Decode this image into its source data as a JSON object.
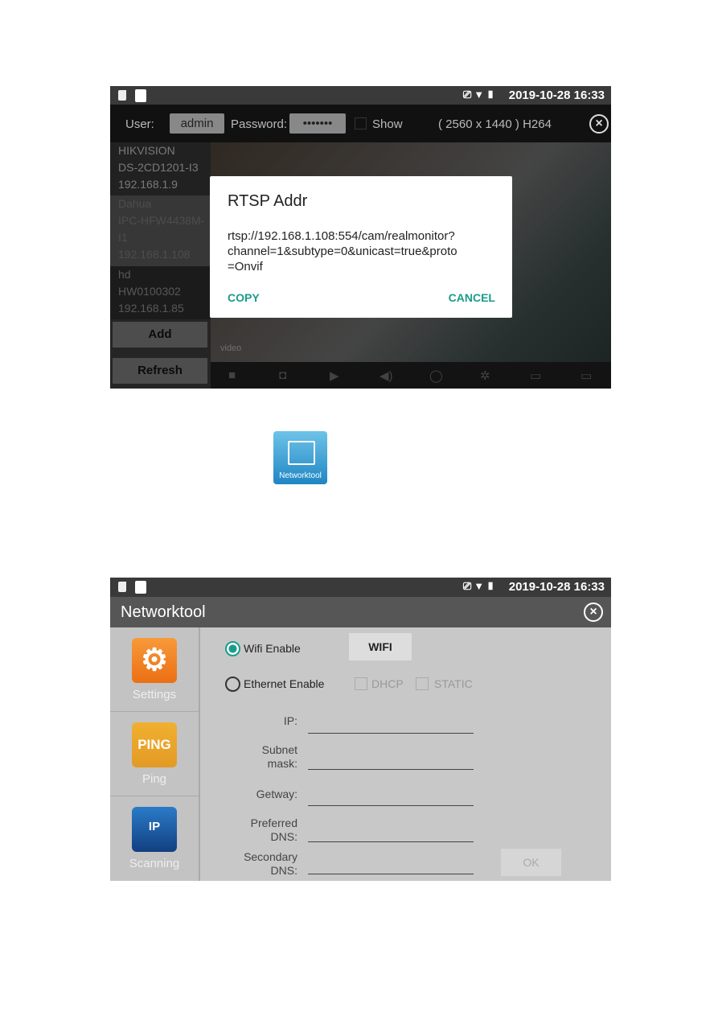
{
  "screen1": {
    "status": {
      "datetime": "2019-10-28 16:33"
    },
    "toolbar": {
      "user_label": "User:",
      "user_value": "admin",
      "password_label": "Password:",
      "password_value": "•••••••",
      "show_label": "Show",
      "resolution": "( 2560 x 1440 ) H264"
    },
    "cameras": [
      {
        "brand": "HIKVISION",
        "model": "DS-2CD1201-I3",
        "ip": "192.168.1.9"
      },
      {
        "brand": "Dahua",
        "model": "IPC-HFW4438M-",
        "model2": "I1",
        "ip": "192.168.1.108"
      },
      {
        "brand": "hd",
        "model": "HW0100302",
        "ip": "192.168.1.85"
      }
    ],
    "add_label": "Add",
    "refresh_label": "Refresh",
    "video_label": "video",
    "video_icons": [
      "record-icon",
      "camera-icon",
      "play-icon",
      "volume-icon",
      "talk-icon",
      "settings-icon",
      "screen-icon",
      "rtsp-icon"
    ],
    "dialog": {
      "title": "RTSP Addr",
      "url_line1": "rtsp://192.168.1.108:554/cam/realmonitor?",
      "url_line2": "channel=1&subtype=0&unicast=true&proto",
      "url_line3": "=Onvif",
      "copy": "COPY",
      "cancel": "CANCEL",
      "accent": "#1a9c8a"
    }
  },
  "app_icon": {
    "label": "Networktool"
  },
  "screen2": {
    "status": {
      "datetime": "2019-10-28 16:33"
    },
    "title": "Networktool",
    "sidebar": [
      {
        "label": "Settings",
        "color": "#f07a1e"
      },
      {
        "label": "Ping",
        "icon_text": "PING",
        "color": "#e9a52a"
      },
      {
        "label": "Scanning",
        "icon_text": "IP",
        "color": "#1b5aa0"
      }
    ],
    "wifi_enable": "Wifi Enable",
    "wifi_button": "WIFI",
    "ethernet_enable": "Ethernet Enable",
    "dhcp": "DHCP",
    "static": "STATIC",
    "fields": {
      "ip": "IP:",
      "subnet1": "Subnet",
      "subnet2": "mask:",
      "gateway": "Getway:",
      "pdns1": "Preferred",
      "pdns2": "DNS:",
      "sdns1": "Secondary",
      "sdns2": "DNS:"
    },
    "ok": "OK"
  }
}
